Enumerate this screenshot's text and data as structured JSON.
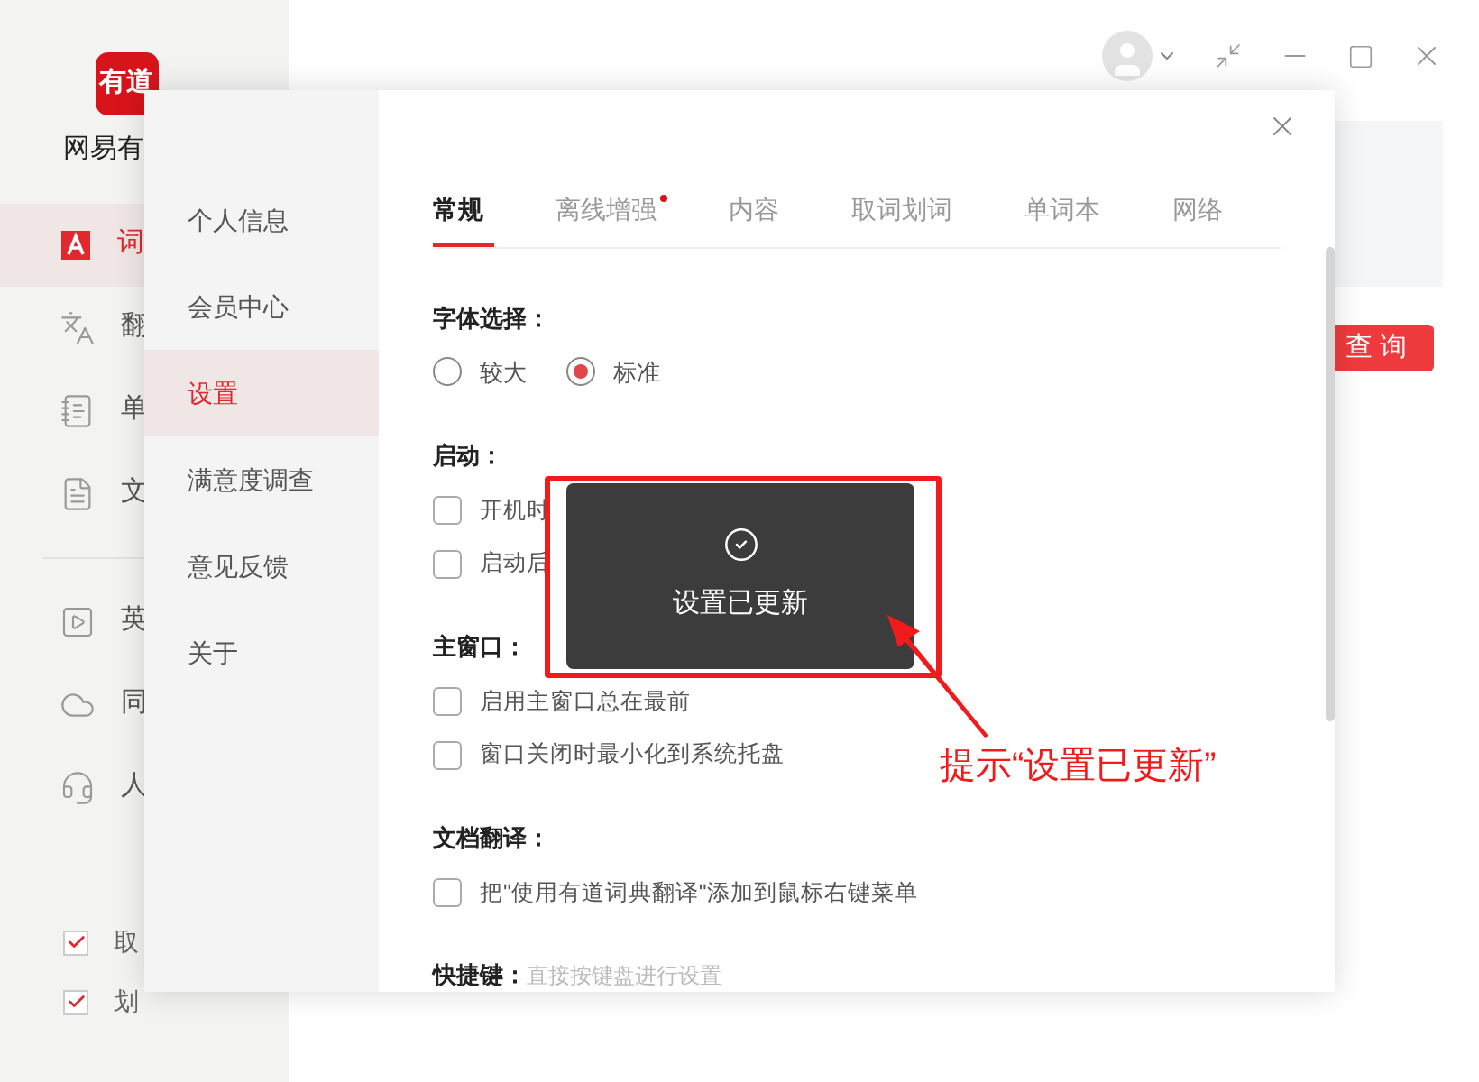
{
  "app": {
    "logo_text": "有道",
    "name": "网易有",
    "nav": [
      {
        "label": "词",
        "selected": true
      },
      {
        "label": "翻",
        "selected": false
      },
      {
        "label": "单",
        "selected": false
      },
      {
        "label": "文",
        "selected": false
      }
    ],
    "nav_secondary": [
      {
        "label": "英",
        "selected": false
      },
      {
        "label": "同",
        "selected": false
      },
      {
        "label": "人",
        "selected": false
      }
    ],
    "toggles": [
      {
        "label": "取",
        "checked": true
      },
      {
        "label": "划",
        "checked": true
      }
    ],
    "search_button": "查 询"
  },
  "dialog": {
    "nav": [
      {
        "label": "个人信息",
        "selected": false
      },
      {
        "label": "会员中心",
        "selected": false
      },
      {
        "label": "设置",
        "selected": true
      },
      {
        "label": "满意度调查",
        "selected": false
      },
      {
        "label": "意见反馈",
        "selected": false
      },
      {
        "label": "关于",
        "selected": false
      }
    ],
    "tabs": [
      {
        "label": "常规",
        "selected": true,
        "dot": false
      },
      {
        "label": "离线增强",
        "selected": false,
        "dot": true
      },
      {
        "label": "内容",
        "selected": false,
        "dot": false
      },
      {
        "label": "取词划词",
        "selected": false,
        "dot": false
      },
      {
        "label": "单词本",
        "selected": false,
        "dot": false
      },
      {
        "label": "网络",
        "selected": false,
        "dot": false
      }
    ],
    "sections": [
      {
        "kind": "radio",
        "title": "字体选择：",
        "options": [
          {
            "label": "较大",
            "selected": false
          },
          {
            "label": "标准",
            "selected": true
          }
        ]
      },
      {
        "kind": "checkbox",
        "title": "启动：",
        "options": [
          {
            "label": "开机时",
            "checked": false
          },
          {
            "label": "启动后",
            "checked": false
          }
        ]
      },
      {
        "kind": "checkbox",
        "title": "主窗口：",
        "options": [
          {
            "label": "启用主窗口总在最前",
            "checked": false
          },
          {
            "label": "窗口关闭时最小化到系统托盘",
            "checked": false
          }
        ]
      },
      {
        "kind": "checkbox",
        "title": "文档翻译：",
        "options": [
          {
            "label": "把\"使用有道词典翻译\"添加到鼠标右键菜单",
            "checked": false
          }
        ]
      },
      {
        "kind": "hint",
        "title": "快捷键：",
        "hint": "直接按键盘进行设置"
      }
    ]
  },
  "toast": {
    "message": "设置已更新"
  },
  "annotation": {
    "text": "提示“设置已更新”"
  }
}
